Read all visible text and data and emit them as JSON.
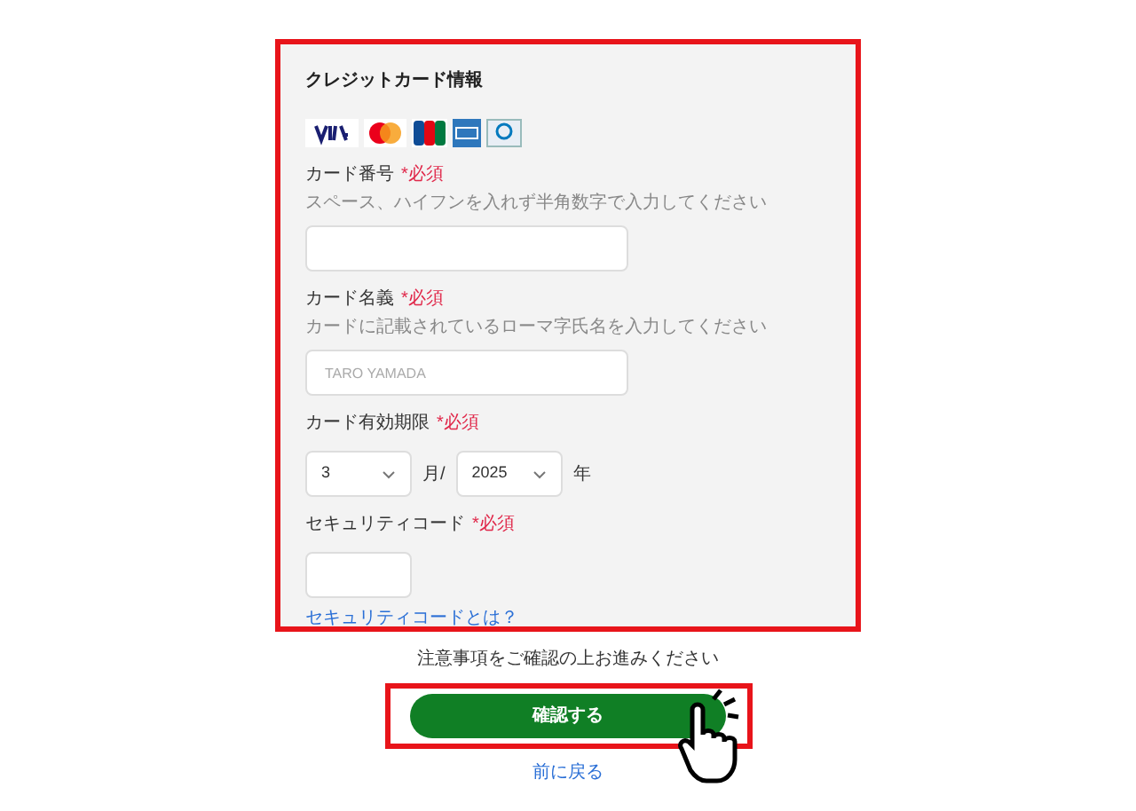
{
  "section_title": "クレジットカード情報",
  "card_brands": [
    {
      "kind": "visa"
    },
    {
      "kind": "mastercard"
    },
    {
      "kind": "jcb"
    },
    {
      "kind": "amex"
    },
    {
      "kind": "diners"
    }
  ],
  "fields": [
    {
      "kind": "text",
      "label": "カード番号",
      "required": "*必須",
      "hint": "スペース、ハイフンを入れず半角数字で入力してください"
    },
    {
      "kind": "text",
      "label": "カード名義",
      "required": "*必須",
      "hint": "カードに記載されているローマ字氏名を入力してください",
      "placeholder": "TARO YAMADA"
    },
    {
      "kind": "expiry",
      "label": "カード有効期限",
      "required": "*必須",
      "month": "3",
      "month_unit": "月/",
      "year": "2025",
      "year_unit": "年"
    },
    {
      "kind": "code",
      "label": "セキュリティコード",
      "required": "*必須",
      "link": "セキュリティコードとは？"
    }
  ],
  "notice": "注意事項をご確認の上お進みください",
  "confirm_button": "確認する",
  "back_link": "前に戻る"
}
